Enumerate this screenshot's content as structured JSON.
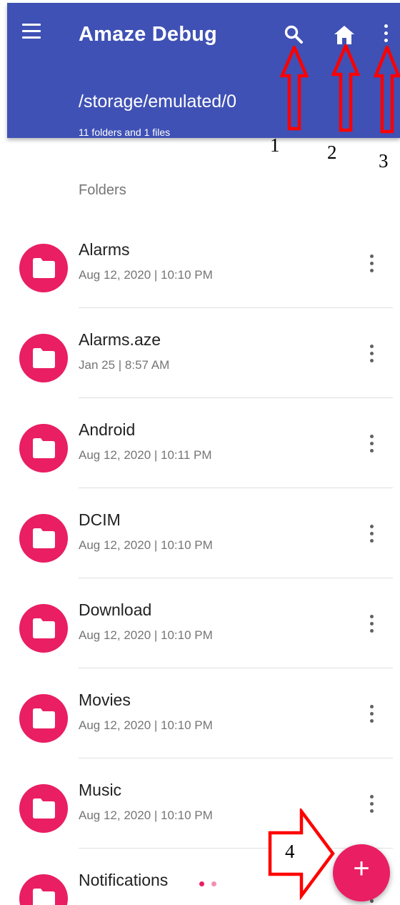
{
  "colors": {
    "app_bar": "#3f51b5",
    "accent": "#e91e63",
    "annotation": "#ff0000"
  },
  "app_bar": {
    "title": "Amaze Debug",
    "path": "/storage/emulated/0",
    "summary": "11 folders and 1 files",
    "icons": [
      "menu-icon",
      "search-icon",
      "home-icon",
      "more-vert-icon"
    ]
  },
  "annotations": [
    "1",
    "2",
    "3",
    "4"
  ],
  "section_header": "Folders",
  "folders": [
    {
      "name": "Alarms",
      "date": "Aug 12, 2020 | 10:10 PM"
    },
    {
      "name": "Alarms.aze",
      "date": "Jan 25 | 8:57 AM"
    },
    {
      "name": "Android",
      "date": "Aug 12, 2020 | 10:11 PM"
    },
    {
      "name": "DCIM",
      "date": "Aug 12, 2020 | 10:10 PM"
    },
    {
      "name": "Download",
      "date": "Aug 12, 2020 | 10:10 PM"
    },
    {
      "name": "Movies",
      "date": "Aug 12, 2020 | 10:10 PM"
    },
    {
      "name": "Music",
      "date": "Aug 12, 2020 | 10:10 PM"
    },
    {
      "name": "Notifications",
      "date": ""
    }
  ],
  "fab": {
    "label": "+"
  }
}
